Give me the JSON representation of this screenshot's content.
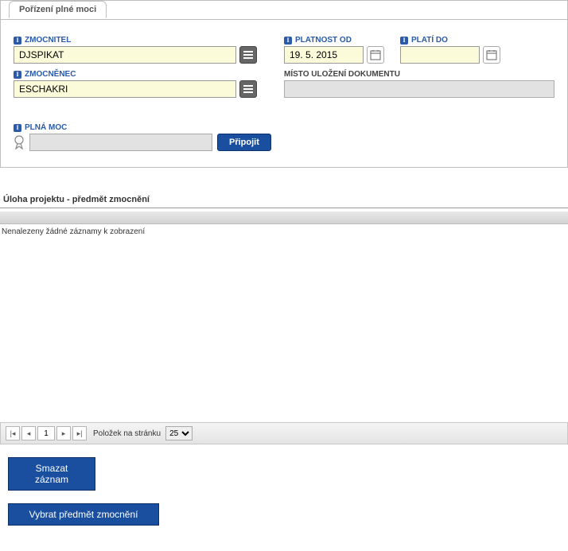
{
  "tab": {
    "title": "Pořízení plné moci"
  },
  "form": {
    "zmocnitel": {
      "label": "ZMOCNITEL",
      "value": "DJSPIKAT"
    },
    "zmocnenec": {
      "label": "ZMOCNĚNEC",
      "value": "ESCHAKRI"
    },
    "platnost_od": {
      "label": "PLATNOST OD",
      "value": "19. 5. 2015"
    },
    "plati_do": {
      "label": "PLATÍ DO",
      "value": ""
    },
    "misto": {
      "label": "MÍSTO ULOŽENÍ DOKUMENTU",
      "value": ""
    },
    "plna_moc": {
      "label": "PLNÁ MOC",
      "value": "",
      "attach_btn": "Připojit"
    }
  },
  "grid": {
    "section_title": "Úloha projektu - předmět zmocnění",
    "empty_text": "Nenalezeny žádné záznamy k zobrazení",
    "pager": {
      "page": "1",
      "perpage_label": "Položek na stránku",
      "perpage_value": "25"
    }
  },
  "actions": {
    "delete": "Smazat záznam",
    "select_subject": "Vybrat předmět zmocnění"
  }
}
